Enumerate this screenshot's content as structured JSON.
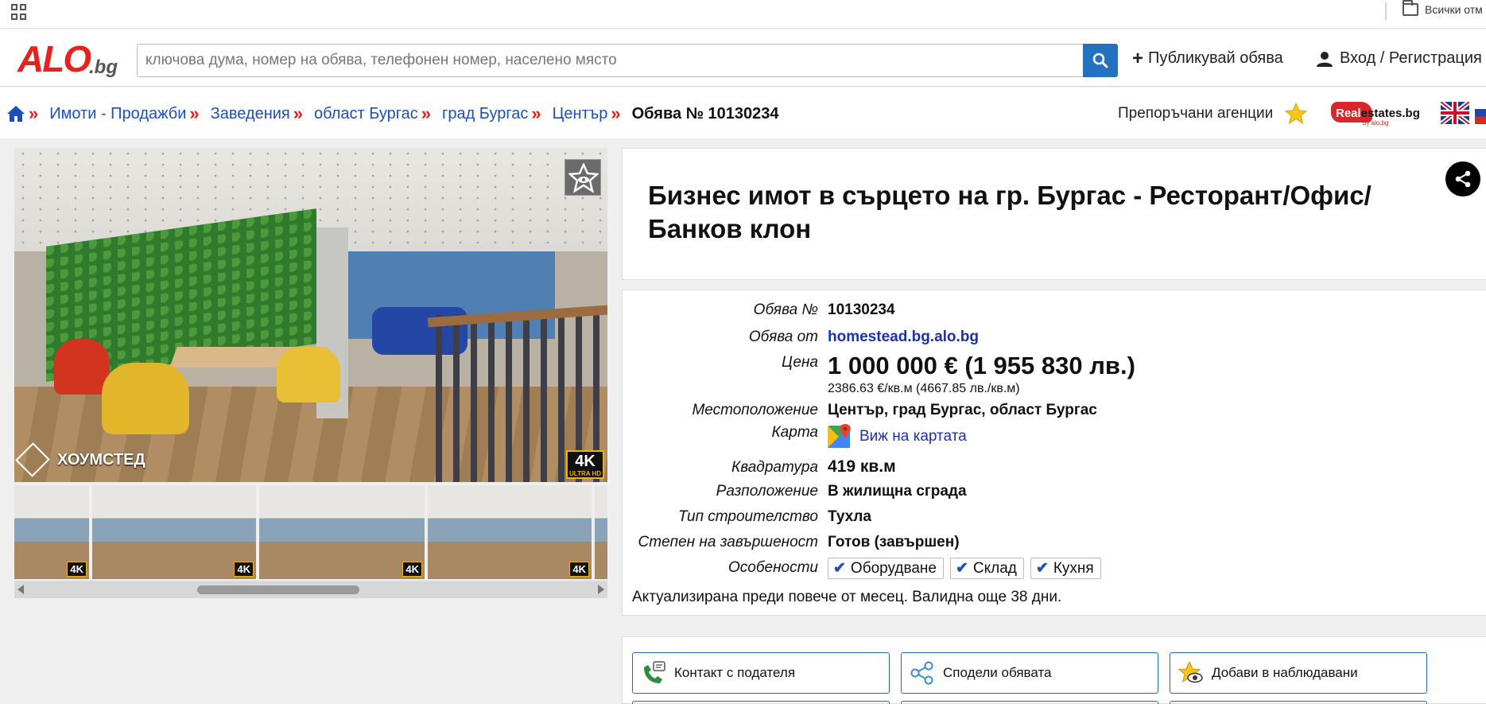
{
  "browser": {
    "bookmark_folder": "Всички отм"
  },
  "header": {
    "logo_main": "ALO",
    "logo_suffix": ".bg",
    "search_placeholder": "ключова дума, номер на обява, телефонен номер, населено място",
    "publish_label": "Публикувай обява",
    "login_label": "Вход / Регистрация"
  },
  "breadcrumb": {
    "items": [
      "Имоти - Продажби",
      "Заведения",
      "област Бургас",
      "град Бургас",
      "Център"
    ],
    "current": "Обява № 10130234",
    "separator": "»"
  },
  "agencies": {
    "label": "Препоръчани агенции",
    "partner_logo": "Realestates.bg",
    "partner_logo_red": "Real",
    "partner_logo_dark": "estates.bg",
    "partner_by": "by alo.bg"
  },
  "gallery": {
    "watermark": "ХОУМСТЕД",
    "badge_main": "4K",
    "badge_sub": "ULTRA HD",
    "thumb_badge": "4K",
    "thumb_count": 5
  },
  "listing": {
    "title": "Бизнес имот в сърцето на гр. Бургас - Ресторант/Офис/Банков клон",
    "fields": {
      "id_label": "Обява №",
      "id_value": "10130234",
      "from_label": "Обява от",
      "from_value": "homestead.bg.alo.bg",
      "price_label": "Цена",
      "price_value": "1 000 000 € (1 955 830 лв.)",
      "price_per_sqm": "2386.63 €/кв.м (4667.85 лв./кв.м)",
      "location_label": "Местоположение",
      "location_value": "Център, град Бургас, област Бургас",
      "map_label": "Карта",
      "map_value": "Виж на картата",
      "area_label": "Квадратура",
      "area_value": "419 кв.м",
      "placement_label": "Разположение",
      "placement_value": "В жилищна сграда",
      "construction_label": "Тип строителство",
      "construction_value": "Тухла",
      "completion_label": "Степен на завършеност",
      "completion_value": "Готов (завършен)",
      "features_label": "Особености",
      "features": [
        "Оборудване",
        "Склад",
        "Кухня"
      ]
    },
    "updated_note": "Актуализирана преди повече от месец. Валидна още 38 дни."
  },
  "actions": {
    "contact": "Контакт с подателя",
    "share": "Сподели обявата",
    "watch": "Добави в наблюдавани"
  },
  "colors": {
    "brand_red": "#e8211c",
    "link_blue": "#1d50b6",
    "search_button": "#2372c0"
  }
}
